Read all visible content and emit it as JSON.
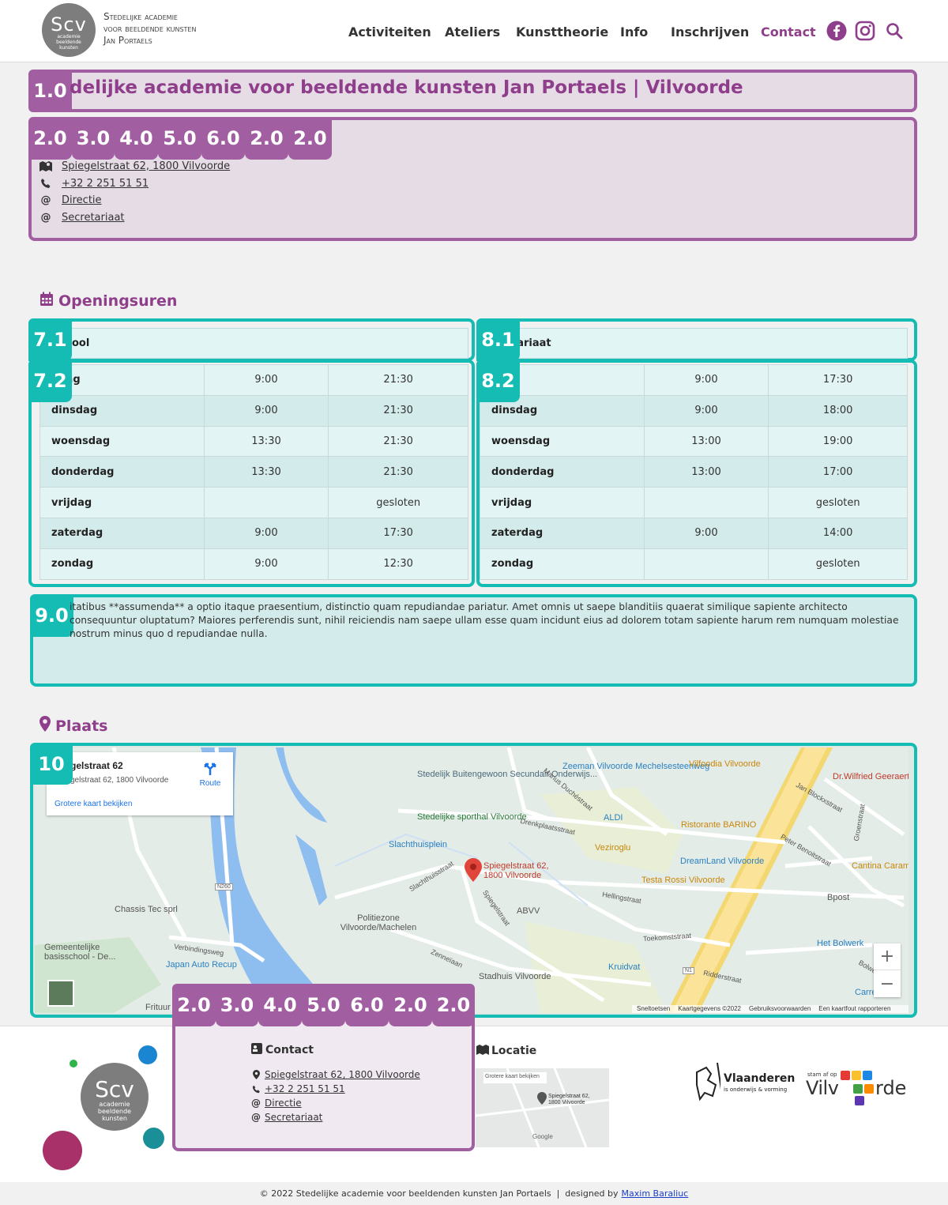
{
  "header": {
    "logo_big": "Scv",
    "logo_small": [
      "academie",
      "beeldende",
      "kunsten"
    ],
    "logo_text": [
      "Stedelijke academie",
      "voor beeldende kunsten",
      "Jan Portaels"
    ],
    "nav": [
      "Activiteiten",
      "Ateliers",
      "Kunsttheorie",
      "Info",
      "Inschrijven",
      "Contact"
    ],
    "social": [
      "facebook-icon",
      "instagram-icon",
      "search-icon"
    ]
  },
  "colors": {
    "purple": "#8e3e8a",
    "purple_border": "#a15fa1",
    "teal": "#14bcb4"
  },
  "page": {
    "title": "delijke academie voor beeldende kunsten Jan Portaels | Vilvoorde",
    "title_badge": "1.0",
    "contact_badges": [
      "2.0",
      "3.0",
      "4.0",
      "5.0",
      "6.0",
      "2.0",
      "2.0"
    ],
    "address": "Spiegelstraat 62, 1800 Vilvoorde",
    "phone": "+32 2 251 51 51",
    "directie": "Directie",
    "secretariaat": "Secretariaat"
  },
  "hours": {
    "title": "Openingsuren",
    "school": {
      "badge_head": "7.1",
      "badge_table": "7.2",
      "head": "ool",
      "rows": [
        [
          "ndag",
          "9:00",
          "21:30"
        ],
        [
          "dinsdag",
          "9:00",
          "21:30"
        ],
        [
          "woensdag",
          "13:30",
          "21:30"
        ],
        [
          "donderdag",
          "13:30",
          "21:30"
        ],
        [
          "vrijdag",
          "",
          "gesloten"
        ],
        [
          "zaterdag",
          "9:00",
          "17:30"
        ],
        [
          "zondag",
          "9:00",
          "12:30"
        ]
      ]
    },
    "secretariaat": {
      "badge_head": "8.1",
      "badge_table": "8.2",
      "head": "tariaat",
      "rows": [
        [
          "dag",
          "9:00",
          "17:30"
        ],
        [
          "dinsdag",
          "9:00",
          "18:00"
        ],
        [
          "woensdag",
          "13:00",
          "19:00"
        ],
        [
          "donderdag",
          "13:00",
          "17:00"
        ],
        [
          "vrijdag",
          "",
          "gesloten"
        ],
        [
          "zaterdag",
          "9:00",
          "14:00"
        ],
        [
          "zondag",
          "",
          "gesloten"
        ]
      ]
    }
  },
  "notice": {
    "badge": "9.0",
    "text": "itatibus **assumenda** a optio itaque praesentium, distinctio quam repudiandae pariatur. Amet omnis ut saepe blanditiis quaerat similique sapiente architecto consequuntur oluptatum? Maiores perferendis sunt, nihil reiciendis nam saepe ullam esse quam incidunt eius ad dolorem totam sapiente harum rem numquam molestiae nostrum minus quo d repudiandae nulla."
  },
  "place": {
    "title": "Plaats",
    "badge": "10",
    "card_title": "gelstraat 62",
    "card_address": "gelstraat 62, 1800 Vilvoorde",
    "card_route": "Route",
    "card_link": "Grotere kaart bekijken",
    "pin_label": "Spiegelstraat 62, 1800 Vilvoorde",
    "labels": [
      "Stedelijk Buitengewoon Secundair Onderwijs...",
      "Zeeman Vilvoorde Mechelsesteenweg",
      "Vilfoodia Vilvoorde",
      "Dr.Wilfried Geeraerts",
      "ALDI",
      "Stedelijke sporthal Vilvoorde",
      "Slachthuisplein",
      "Ristorante BARINO",
      "Veziroglu",
      "DreamLand Vilvoorde",
      "Cantina Caramba",
      "Testa Rossi Vilvoorde",
      "Chassis Tec sprl",
      "ABVV",
      "Bpost",
      "Politiezone Vilvoorde/Machelen",
      "Gemeentelijke basisschool - De...",
      "Japan Auto Recup",
      "Het Bolwerk",
      "Kruidvat",
      "Stadhuis Vilvoorde",
      "Frituur",
      "Carrefour"
    ],
    "streets": [
      "Drenkplaatsstraat",
      "Slachthuisstraat",
      "Spiegelstraat",
      "Hellingstraat",
      "Toekomststraat",
      "Ridderstraat",
      "Zenneïaan",
      "Verbindingsweg",
      "Marius Duchéstraat",
      "Jan Blockxstraat",
      "Peter Benoitstraat",
      "Groenstraat",
      "Bolwerkstraat",
      "N260",
      "N1"
    ],
    "footer_bits": [
      "Sneltoetsen",
      "Kaartgegevens ©2022",
      "Gebruiksvoorwaarden",
      "Een kaartfout rapporteren"
    ],
    "zoom_in": "+",
    "zoom_out": "−"
  },
  "footer": {
    "badges": [
      "2.0",
      "3.0",
      "4.0",
      "5.0",
      "6.0",
      "2.0",
      "2.0"
    ],
    "contact_title": "Contact",
    "locatie_title": "Locatie",
    "address": "Spiegelstraat 62, 1800 Vilvoorde",
    "phone": "+32 2 251 51 51",
    "directie": "Directie",
    "secretariaat": "Secretariaat",
    "mini_map_link": "Grotere kaart bekijken",
    "mini_map_pin": "Spiegelstraat 62, 1800 Vilvoorde",
    "mini_map_google": "Google",
    "vlaanderen": "Vlaanderen",
    "vlaanderen_sub": "is onderwijs & vorming",
    "vilvoorde_top": "stam af op",
    "vilvoorde_left": "Vilv",
    "vilvoorde_right": "rde",
    "copyright": "© 2022 Stedelijke academie voor beeldenden kunsten Jan Portaels  |  designed by",
    "designer": "Maxim Baraliuc"
  }
}
